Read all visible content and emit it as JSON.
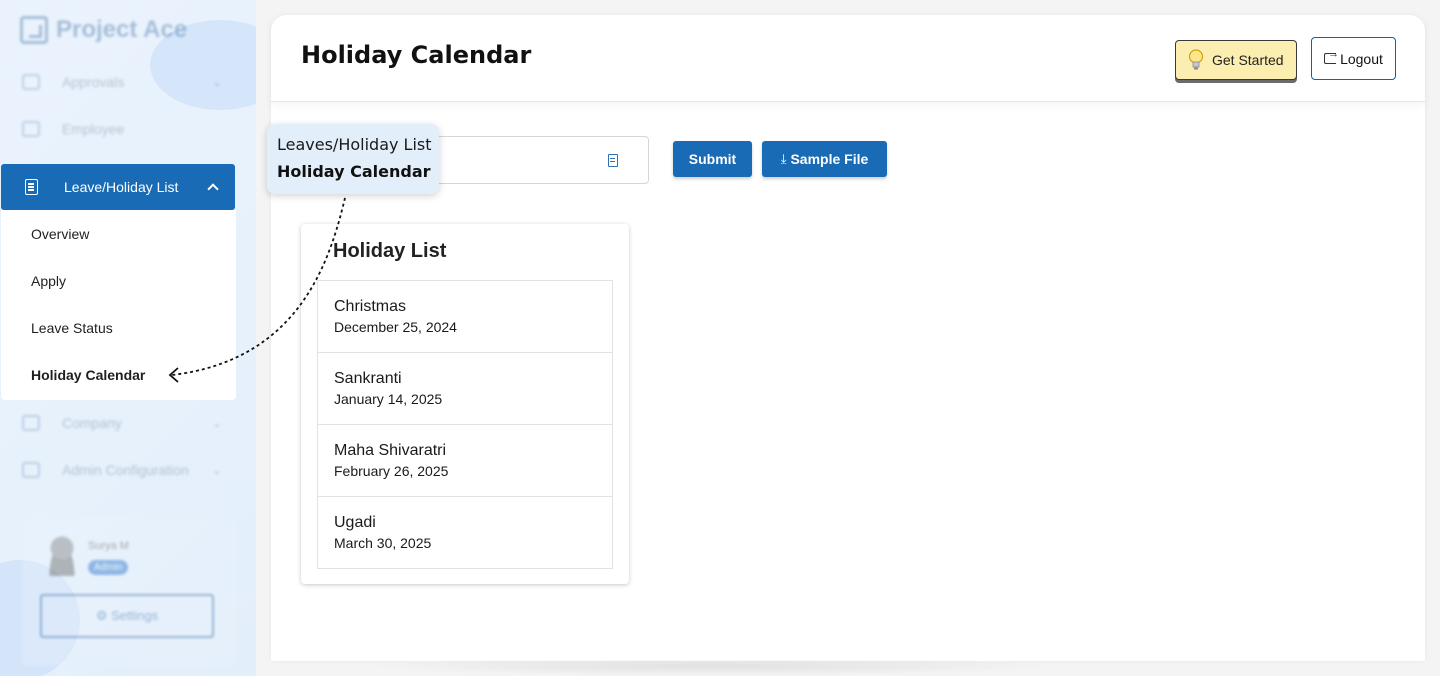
{
  "app": {
    "name": "Project Ace"
  },
  "sidebar": {
    "items": [
      {
        "label": "Approvals",
        "icon": "calendar-icon"
      },
      {
        "label": "Employee",
        "icon": "person-icon"
      },
      {
        "label": "Leave/Holiday List",
        "icon": "document-icon",
        "active": true
      },
      {
        "label": "Company",
        "icon": "building-icon"
      },
      {
        "label": "Admin Configuration",
        "icon": "gear-icon"
      }
    ],
    "submenu": [
      {
        "label": "Overview"
      },
      {
        "label": "Apply"
      },
      {
        "label": "Leave Status"
      },
      {
        "label": "Holiday Calendar",
        "active": true
      }
    ],
    "user": {
      "name": "Surya M",
      "role": "Admin",
      "settings_label": "⚙ Settings"
    }
  },
  "header": {
    "title": "Holiday Calendar",
    "get_started_label": "Get Started",
    "logout_label": "Logout"
  },
  "upload": {
    "placeholder_fragment": ":",
    "submit_label": "Submit",
    "sample_label": "Sample File"
  },
  "popover": {
    "line1": "Leaves/Holiday List",
    "line2": "Holiday Calendar"
  },
  "holiday_list": {
    "title": "Holiday List",
    "items": [
      {
        "name": "Christmas",
        "date": "December 25, 2024"
      },
      {
        "name": "Sankranti",
        "date": "January 14, 2025"
      },
      {
        "name": "Maha Shivaratri",
        "date": "February 26, 2025"
      },
      {
        "name": "Ugadi",
        "date": "March 30, 2025"
      }
    ]
  },
  "colors": {
    "primary": "#1a6bb5",
    "get_started_bg": "#fbeeb0",
    "sidebar_bg": "#e6f1fc"
  }
}
